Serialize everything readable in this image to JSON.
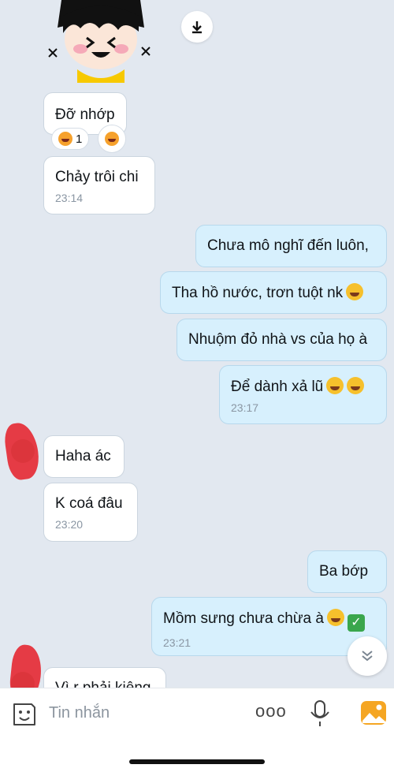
{
  "messages": {
    "m1": {
      "text": "Đỡ nhớp",
      "reaction_count": "1"
    },
    "m2": {
      "text": "Chảy trôi chi",
      "time": "23:14"
    },
    "m3": {
      "text": "Chưa mô nghĩ đến luôn,"
    },
    "m4": {
      "text": "Tha hồ nước, trơn tuột nk"
    },
    "m5": {
      "text": "Nhuộm đỏ nhà vs của họ à"
    },
    "m6": {
      "text": "Để dành xả lũ",
      "time": "23:17"
    },
    "m7": {
      "text": "Haha ác"
    },
    "m8": {
      "text": "K coá đâu",
      "time": "23:20"
    },
    "m9": {
      "text": "Ba bớp"
    },
    "m10": {
      "text": "Mồm sưng chưa chừa à",
      "time": "23:21"
    },
    "m11": {
      "text": "Vì r phải kiêng"
    }
  },
  "composer": {
    "placeholder": "Tin nhắn",
    "more": "ooo"
  },
  "icons": {
    "download": "download-icon",
    "scroll_down": "chevron-double-down-icon",
    "sticker": "sticker-face-icon",
    "mic": "microphone-icon",
    "image": "image-icon",
    "emoji": "laughing-emoji-icon",
    "check": "checkmark-icon"
  },
  "colors": {
    "outgoing": "#d7f0fd",
    "incoming": "#ffffff",
    "background": "#e2e8f0",
    "accent": "#f5a623"
  }
}
